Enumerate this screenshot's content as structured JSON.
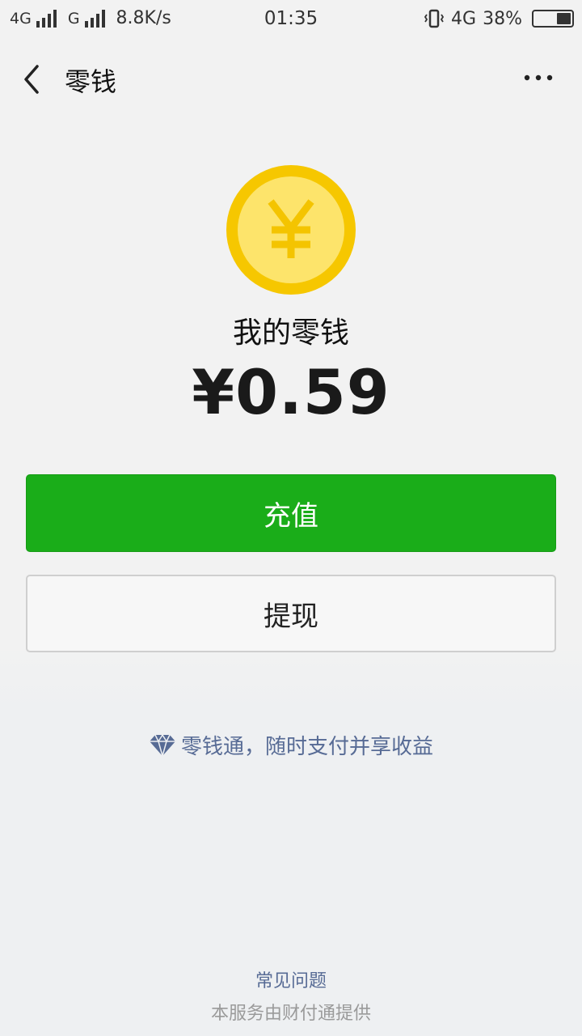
{
  "status_bar": {
    "net1": "4G",
    "net2": "G",
    "speed": "8.8K/s",
    "time": "01:35",
    "net3": "4G",
    "battery": "38%",
    "battery_level": 0.38
  },
  "nav": {
    "title": "零钱"
  },
  "balance": {
    "label": "我的零钱",
    "amount": "¥0.59"
  },
  "actions": {
    "recharge_label": "充值",
    "withdraw_label": "提现"
  },
  "promo": {
    "text": "零钱通，随时支付并享收益",
    "icon": "diamond-icon"
  },
  "footer": {
    "faq_label": "常见问题",
    "provider_text": "本服务由财付通提供"
  },
  "colors": {
    "primary_green": "#1aad19",
    "link_blue": "#576b95",
    "coin_outer": "#f6c700",
    "coin_inner": "#fde46b"
  }
}
